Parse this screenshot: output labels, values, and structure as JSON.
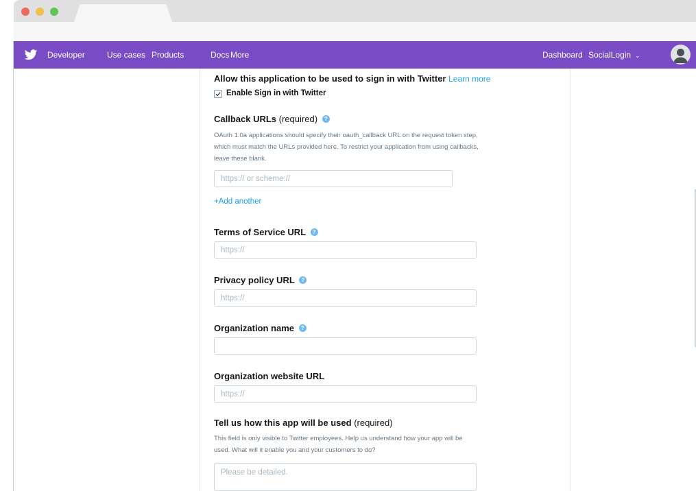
{
  "nav": {
    "brand": "Developer",
    "links": [
      "Use cases",
      "Products",
      "Docs",
      "More"
    ],
    "dashboard": "Dashboard",
    "account": "SocialLogin",
    "accent_color": "#794bc4"
  },
  "form": {
    "signin": {
      "title": "Allow this application to be used to sign in with Twitter",
      "learn_more": "Learn more",
      "checkbox_label": "Enable Sign in with Twitter",
      "checked": true
    },
    "callback": {
      "title": "Callback URLs",
      "required": "(required)",
      "help": "OAuth 1.0a applications should specify their oauth_callback URL on the request token step, which must match the URLs provided here. To restrict your application from using callbacks, leave these blank.",
      "placeholder": "https:// or scheme://",
      "add_another": "+Add another"
    },
    "terms": {
      "title": "Terms of Service URL",
      "placeholder": "https://"
    },
    "privacy": {
      "title": "Privacy policy URL",
      "placeholder": "https://"
    },
    "org_name": {
      "title": "Organization name",
      "placeholder": ""
    },
    "org_website": {
      "title": "Organization website URL",
      "placeholder": "https://"
    },
    "usage": {
      "title": "Tell us how this app will be used",
      "required": "(required)",
      "help": "This field is only visible to Twitter employees. Help us understand how your app will be used. What will it enable you and your customers to do?",
      "placeholder": "Please be detailed."
    }
  }
}
